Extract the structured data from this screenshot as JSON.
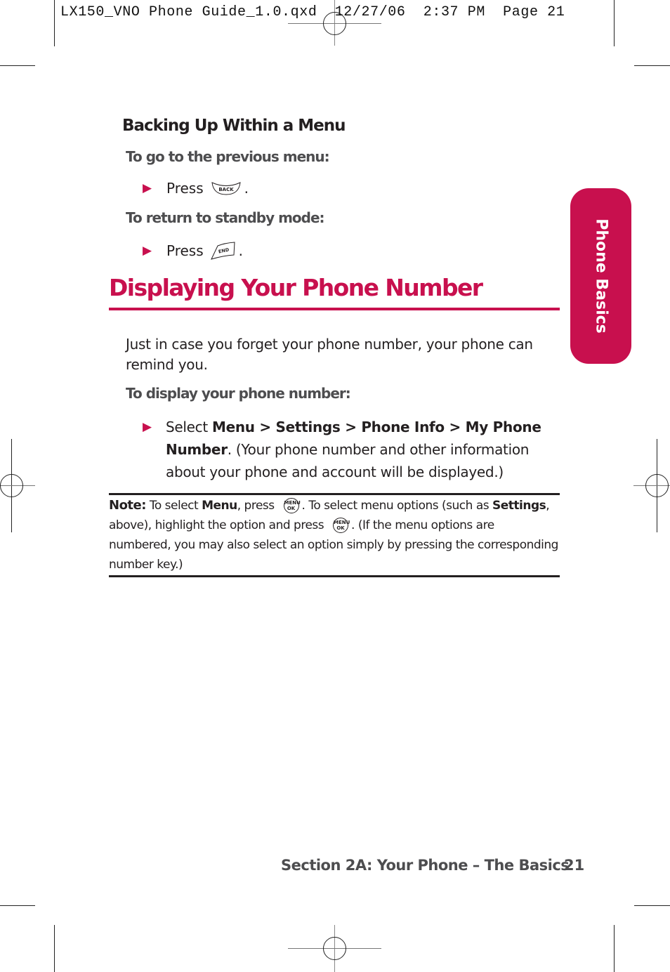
{
  "slug": {
    "file": "LX150_VNO Phone Guide_1.0.qxd",
    "date": "12/27/06",
    "time": "2:37 PM",
    "page_label": "Page 21"
  },
  "side_tab": {
    "label": "Phone Basics",
    "color": "#c8104e"
  },
  "backing_up": {
    "heading": "Backing Up Within a Menu",
    "previous_menu": {
      "lead": "To go to the previous menu:",
      "step_prefix": "Press",
      "key_icon": "back-key-icon",
      "key_label": "BACK",
      "step_suffix": "."
    },
    "standby": {
      "lead": "To return to standby mode:",
      "step_prefix": "Press",
      "key_icon": "end-key-icon",
      "key_label": "END",
      "step_suffix": "."
    }
  },
  "section": {
    "title": "Displaying Your Phone Number",
    "intro": "Just in case you forget your phone number, your phone can remind you.",
    "lead": "To display your phone number:",
    "step": {
      "prefix": "Select ",
      "path": [
        "Menu",
        "Settings",
        "Phone Info",
        "My Phone Number"
      ],
      "separator": " > ",
      "suffix": ".",
      "explanation": "(Your phone number and other information about your phone and account will be displayed.)"
    }
  },
  "note": {
    "label": "Note:",
    "part1": " To select ",
    "bold1": "Menu",
    "part2": ", press ",
    "part3": ". To select menu options (such as ",
    "bold2": "Settings",
    "part4": ", above), highlight the option and press ",
    "part5": ". (If the menu options are numbered, you may also select an option simply by pressing the corresponding number key.)",
    "key_top": "MENU",
    "key_bottom": "OK"
  },
  "footer": {
    "section": "Section 2A: Your Phone – The Basics",
    "page_number": "21"
  },
  "colors": {
    "accent": "#c8104e",
    "text": "#231f20",
    "lead_gray": "#4d4d4f"
  }
}
